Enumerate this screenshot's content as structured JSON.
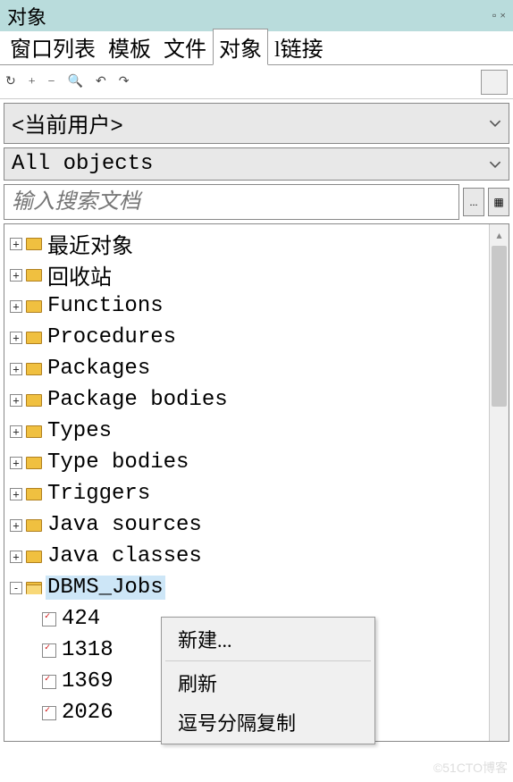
{
  "titlebar": {
    "title": "对象"
  },
  "tabs": [
    "窗口列表",
    "模板",
    "文件",
    "对象",
    "l链接"
  ],
  "active_tab_index": 3,
  "dropdown_user": "<当前用户>",
  "dropdown_filter": "All objects",
  "search": {
    "placeholder": "输入搜索文档"
  },
  "tree": [
    {
      "label": "最近对象",
      "level": 0,
      "icon": "folder",
      "expand": "+"
    },
    {
      "label": "回收站",
      "level": 0,
      "icon": "folder",
      "expand": "+"
    },
    {
      "label": "Functions",
      "level": 0,
      "icon": "folder",
      "expand": "+"
    },
    {
      "label": "Procedures",
      "level": 0,
      "icon": "folder",
      "expand": "+"
    },
    {
      "label": "Packages",
      "level": 0,
      "icon": "folder",
      "expand": "+"
    },
    {
      "label": "Package bodies",
      "level": 0,
      "icon": "folder",
      "expand": "+"
    },
    {
      "label": "Types",
      "level": 0,
      "icon": "folder",
      "expand": "+"
    },
    {
      "label": "Type bodies",
      "level": 0,
      "icon": "folder",
      "expand": "+"
    },
    {
      "label": "Triggers",
      "level": 0,
      "icon": "folder",
      "expand": "+"
    },
    {
      "label": "Java sources",
      "level": 0,
      "icon": "folder",
      "expand": "+"
    },
    {
      "label": "Java classes",
      "level": 0,
      "icon": "folder",
      "expand": "+"
    },
    {
      "label": "DBMS_Jobs",
      "level": 0,
      "icon": "folder-open",
      "expand": "-",
      "selected": true
    },
    {
      "label": "424",
      "level": 1,
      "icon": "job"
    },
    {
      "label": "1318",
      "level": 1,
      "icon": "job"
    },
    {
      "label": "1369",
      "level": 1,
      "icon": "job"
    },
    {
      "label": "2026",
      "level": 1,
      "icon": "job"
    }
  ],
  "context_menu": {
    "items": [
      "新建...",
      "刷新",
      "逗号分隔复制"
    ]
  },
  "watermark": "©51CTO博客"
}
